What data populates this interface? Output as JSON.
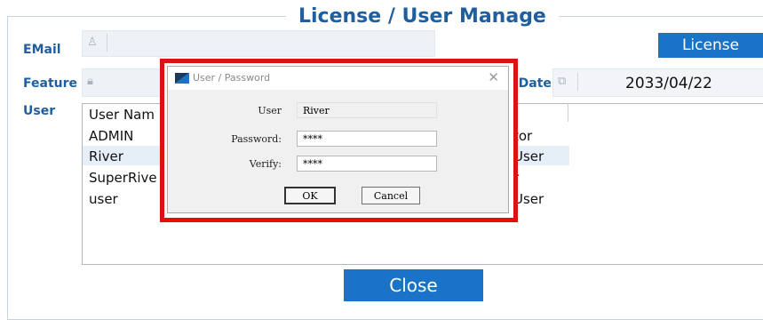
{
  "window": {
    "title": "License / User Manage"
  },
  "form": {
    "email_label": "EMail",
    "feature_label": "Feature",
    "user_label": "User",
    "expire_label": "l Date",
    "expire_value": "2033/04/22",
    "license_button": "License",
    "close_button": "Close"
  },
  "user_list": {
    "header": "User Nam",
    "rows": [
      {
        "name": "ADMIN",
        "role": "tor"
      },
      {
        "name": "River",
        "role": "User"
      },
      {
        "name": "SuperRive",
        "role": "r"
      },
      {
        "name": "user",
        "role": "User"
      }
    ]
  },
  "dialog": {
    "title": "User / Password",
    "close_glyph": "✕",
    "user_label": "User",
    "user_value": "River",
    "password_label": "Password:",
    "password_value": "****",
    "verify_label": "Verify:",
    "verify_value": "****",
    "ok_button": "OK",
    "cancel_button": "Cancel"
  },
  "colors": {
    "accent": "#1a73c6",
    "highlight": "#e01010",
    "label": "#1f5f9f"
  }
}
